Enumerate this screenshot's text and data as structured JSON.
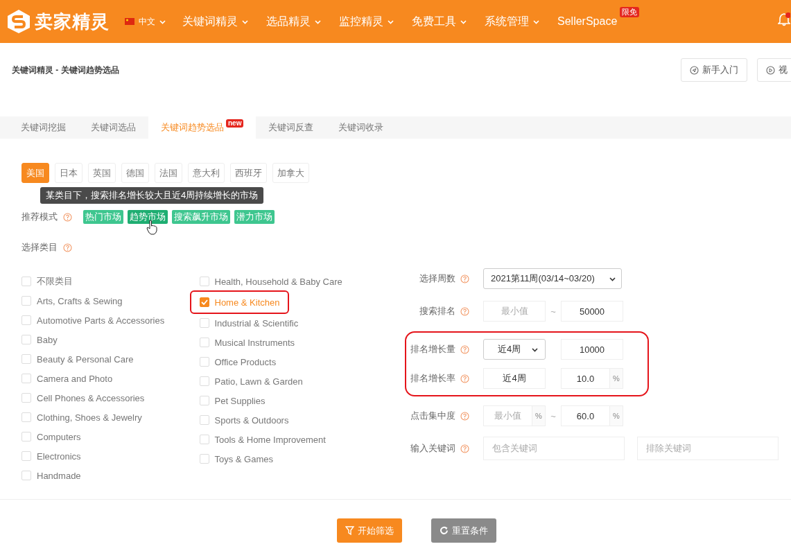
{
  "brand": "卖家精灵",
  "language": "中文",
  "nav": [
    {
      "label": "关键词精灵",
      "caret": true
    },
    {
      "label": "选品精灵",
      "caret": true
    },
    {
      "label": "监控精灵",
      "caret": true
    },
    {
      "label": "免费工具",
      "caret": true
    },
    {
      "label": "系统管理",
      "caret": true
    },
    {
      "label": "SellerSpace",
      "caret": false,
      "badge": "限免"
    }
  ],
  "breadcrumb": "关键词精灵 - 关键词趋势选品",
  "header_buttons": [
    {
      "label": "新手入门"
    },
    {
      "label": "视"
    }
  ],
  "tabs": [
    {
      "label": "关键词挖掘",
      "selected": false
    },
    {
      "label": "关键词选品",
      "selected": false
    },
    {
      "label": "关键词趋势选品",
      "selected": true,
      "badge": "new"
    },
    {
      "label": "关键词反查",
      "selected": false
    },
    {
      "label": "关键词收录",
      "selected": false
    }
  ],
  "markets": [
    {
      "label": "美国",
      "selected": true
    },
    {
      "label": "日本",
      "selected": false
    },
    {
      "label": "英国",
      "selected": false
    },
    {
      "label": "德国",
      "selected": false
    },
    {
      "label": "法国",
      "selected": false
    },
    {
      "label": "意大利",
      "selected": false
    },
    {
      "label": "西班牙",
      "selected": false
    },
    {
      "label": "加拿大",
      "selected": false
    }
  ],
  "tooltip": "某类目下，搜索排名增长较大且近4周持续增长的市场",
  "mode": {
    "label": "推荐模式",
    "options": [
      {
        "label": "热门市场",
        "hovered": false
      },
      {
        "label": "趋势市场",
        "hovered": true
      },
      {
        "label": "搜索飙升市场",
        "hovered": false
      },
      {
        "label": "潜力市场",
        "hovered": false
      }
    ]
  },
  "category_label": "选择类目",
  "categories": [
    [
      {
        "label": "不限类目",
        "checked": false,
        "highlighted": false
      },
      {
        "label": "Arts, Crafts & Sewing",
        "checked": false,
        "highlighted": false
      },
      {
        "label": "Automotive Parts & Accessories",
        "checked": false,
        "highlighted": false
      },
      {
        "label": "Baby",
        "checked": false,
        "highlighted": false
      },
      {
        "label": "Beauty & Personal Care",
        "checked": false,
        "highlighted": false
      },
      {
        "label": "Camera and Photo",
        "checked": false,
        "highlighted": false
      },
      {
        "label": "Cell Phones & Accessories",
        "checked": false,
        "highlighted": false
      },
      {
        "label": "Clothing, Shoes & Jewelry",
        "checked": false,
        "highlighted": false
      },
      {
        "label": "Computers",
        "checked": false,
        "highlighted": false
      },
      {
        "label": "Electronics",
        "checked": false,
        "highlighted": false
      },
      {
        "label": "Handmade",
        "checked": false,
        "highlighted": false
      }
    ],
    [
      {
        "label": "Health, Household & Baby Care",
        "checked": false,
        "highlighted": false
      },
      {
        "label": "Home & Kitchen",
        "checked": true,
        "highlighted": true
      },
      {
        "label": "Industrial & Scientific",
        "checked": false,
        "highlighted": false
      },
      {
        "label": "Musical Instruments",
        "checked": false,
        "highlighted": false
      },
      {
        "label": "Office Products",
        "checked": false,
        "highlighted": false
      },
      {
        "label": "Patio, Lawn & Garden",
        "checked": false,
        "highlighted": false
      },
      {
        "label": "Pet Supplies",
        "checked": false,
        "highlighted": false
      },
      {
        "label": "Sports & Outdoors",
        "checked": false,
        "highlighted": false
      },
      {
        "label": "Tools & Home Improvement",
        "checked": false,
        "highlighted": false
      },
      {
        "label": "Toys & Games",
        "checked": false,
        "highlighted": false
      }
    ]
  ],
  "filters": [
    {
      "label": "选择周数",
      "highlighted": false,
      "controls": [
        {
          "kind": "select",
          "value": "2021第11周(03/14~03/20)"
        }
      ]
    },
    {
      "label": "搜索排名",
      "highlighted": false,
      "controls": [
        {
          "kind": "input",
          "placeholder": "最小值"
        },
        {
          "kind": "sep",
          "text": "~"
        },
        {
          "kind": "input",
          "value": "50000"
        }
      ]
    },
    {
      "label": "排名增长量",
      "highlighted": true,
      "controls": [
        {
          "kind": "select",
          "value": "近4周"
        },
        {
          "kind": "gap"
        },
        {
          "kind": "input",
          "value": "10000"
        }
      ]
    },
    {
      "label": "排名增长率",
      "highlighted": true,
      "controls": [
        {
          "kind": "input",
          "value": "近4周"
        },
        {
          "kind": "gap"
        },
        {
          "kind": "input",
          "value": "10.0",
          "unit": "%"
        }
      ]
    },
    {
      "label": "点击集中度",
      "highlighted": false,
      "controls": [
        {
          "kind": "input",
          "placeholder": "最小值",
          "unit": "%"
        },
        {
          "kind": "sep",
          "text": "~"
        },
        {
          "kind": "input",
          "value": "60.0",
          "unit": "%"
        }
      ]
    },
    {
      "label": "输入关键词",
      "highlighted": false,
      "controls": [
        {
          "kind": "text",
          "placeholder": "包含关键词"
        },
        {
          "kind": "text",
          "placeholder": "排除关键词"
        }
      ]
    }
  ],
  "actions": [
    {
      "label": "开始筛选",
      "kind": "primary"
    },
    {
      "label": "重置条件",
      "kind": "secondary"
    }
  ]
}
